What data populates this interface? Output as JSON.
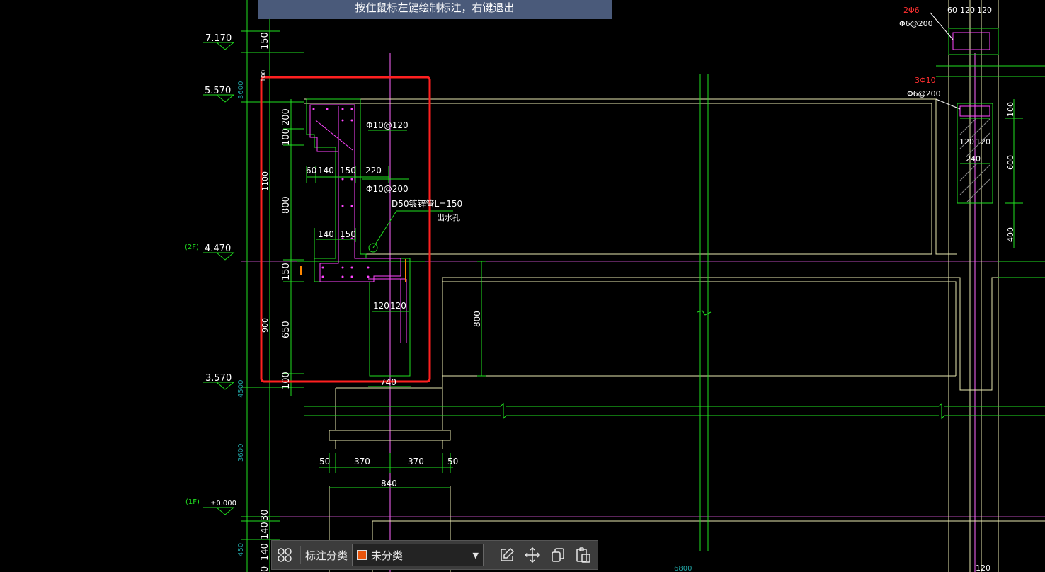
{
  "hint_bar": {
    "text": "按住鼠标左键绘制标注，右键退出"
  },
  "toolbar": {
    "category_label": "标注分类",
    "category_value": "未分类",
    "category_color": "#e8540c",
    "icons": [
      "grid-icon",
      "edit-icon",
      "move-icon",
      "copy-icon",
      "paste-icon"
    ]
  },
  "selection_box_color": "#ff2020",
  "elevations": [
    {
      "value": "7.170"
    },
    {
      "value": "5.570"
    },
    {
      "value": "4.470",
      "floor": "(2F)"
    },
    {
      "value": "3.570"
    },
    {
      "value": "±0.000",
      "floor": "(1F)"
    }
  ],
  "left_dims": {
    "outer": [
      "150",
      "100",
      "3600",
      "1100",
      "900",
      "4500",
      "3600",
      "450",
      "0"
    ],
    "inner": [
      "200",
      "100",
      "800",
      "150",
      "650",
      "100",
      "30",
      "140",
      "140"
    ]
  },
  "rebar_labels": {
    "top_rebar": "Φ10@120",
    "mid_rebar": "Φ10@200",
    "pipe_note": "D50镀锌管L=150",
    "pipe_note_2": "出水孔",
    "dim_top": [
      "60",
      "140",
      "150",
      "220"
    ],
    "dim_mid": [
      "140",
      "150"
    ],
    "dim_bottom": [
      "120",
      "120"
    ],
    "dim_width": "740",
    "beam_height": "800"
  },
  "column_dims": [
    "50",
    "370",
    "370",
    "50"
  ],
  "column_width": "840",
  "right_detail": {
    "top_bars": "2Φ6",
    "top_stirrup": "Φ6@200",
    "top_dims": [
      "60",
      "120",
      "120"
    ],
    "mid_bars": "3Φ10",
    "mid_stirrup": "Φ6@200",
    "mid_dims": [
      "120",
      "120"
    ],
    "width": "240",
    "heights": [
      "100",
      "600",
      "400"
    ],
    "bottom_dim": "120"
  },
  "bottom_dim": "6800"
}
